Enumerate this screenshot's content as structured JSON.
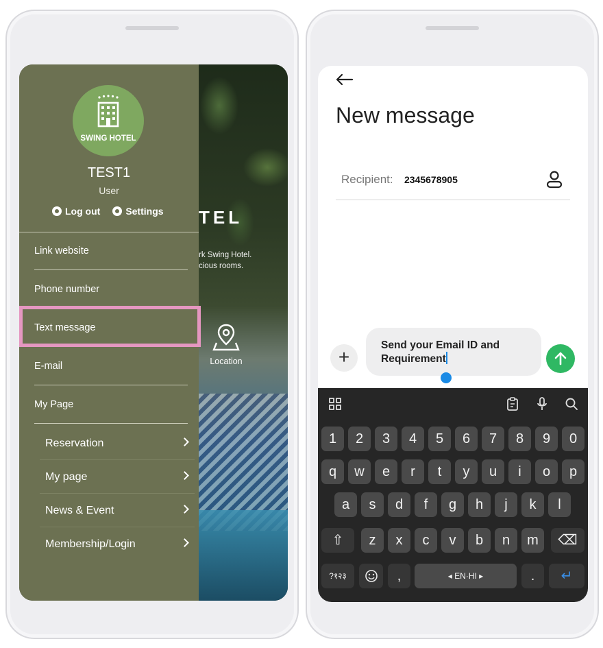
{
  "left_phone": {
    "drawer": {
      "brand": "SWING HOTEL",
      "user_name": "TEST1",
      "user_role": "User",
      "logout_label": "Log  out",
      "settings_label": "Settings",
      "menu": [
        {
          "label": "Link website"
        },
        {
          "label": "Phone number"
        },
        {
          "label": "Text message"
        },
        {
          "label": "E-mail"
        },
        {
          "label": "My Page"
        }
      ],
      "sub_menu": [
        {
          "label": "Reservation"
        },
        {
          "label": "My page"
        },
        {
          "label": "News & Event"
        },
        {
          "label": "Membership/Login"
        }
      ]
    },
    "background": {
      "title_fragment": "TEL",
      "subtitle_line1": "rk Swing Hotel.",
      "subtitle_line2": "cious rooms.",
      "location_label": "Location"
    },
    "highlight_color": "#e597c1"
  },
  "right_phone": {
    "title": "New message",
    "recipient_label": "Recipient:",
    "recipient_value": "2345678905",
    "message_line1": "Send your Email ID and",
    "message_line2": "Requirement",
    "send_color": "#2fb863",
    "keyboard": {
      "row_numbers": [
        "1",
        "2",
        "3",
        "4",
        "5",
        "6",
        "7",
        "8",
        "9",
        "0"
      ],
      "row_1": [
        "q",
        "w",
        "e",
        "r",
        "t",
        "y",
        "u",
        "i",
        "o",
        "p"
      ],
      "row_2": [
        "a",
        "s",
        "d",
        "f",
        "g",
        "h",
        "j",
        "k",
        "l"
      ],
      "row_3": [
        "z",
        "x",
        "c",
        "v",
        "b",
        "n",
        "m"
      ],
      "lang_key": "?१२३",
      "comma": ",",
      "space_label": "EN·HI",
      "period": ".",
      "enter_symbol": "↵",
      "shift_symbol": "⇧",
      "backspace_symbol": "⌫"
    }
  }
}
